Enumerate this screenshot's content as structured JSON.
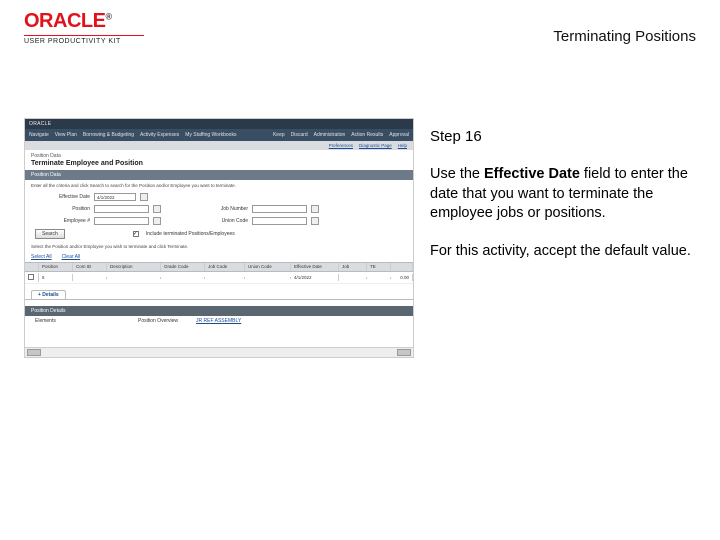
{
  "header": {
    "brand": "ORACLE",
    "brand_sub": "USER PRODUCTIVITY KIT",
    "doc_title": "Terminating Positions"
  },
  "instructions": {
    "step_label": "Step 16",
    "body_pre": "Use the ",
    "body_bold": "Effective Date",
    "body_post": " field to enter the date that you want to terminate the employee jobs or positions.",
    "body2": "For this activity, accept the default value."
  },
  "app": {
    "brand": "ORACLE",
    "nav": {
      "left": [
        "Navigate",
        "View Plan",
        "Borrowing & Budgeting",
        "Activity Expenses",
        "My Staffing Workbooks"
      ],
      "right": [
        "Keep",
        "Discard",
        "Administration",
        "Action Results",
        "Approval"
      ]
    },
    "substrip": {
      "left_link": "Preferences",
      "mid_link": "Diagnostic Page",
      "help": "Help"
    },
    "section_label": "Position Data",
    "page_title": "Terminate Employee and Position",
    "subbar": "Position Data",
    "instr_line": "Enter all the criteria and click Search to search for the Position and/or Employee you want to terminate.",
    "effective_date": {
      "label": "Effective Date",
      "value": "4/1/2022"
    },
    "filters": {
      "row1": [
        {
          "label": "Position",
          "value": ""
        },
        {
          "label": "Job Number",
          "value": ""
        }
      ],
      "row2": [
        {
          "label": "Employee #",
          "value": ""
        },
        {
          "label": "Union Code",
          "value": ""
        }
      ],
      "checkbox_label": "Include terminated Positions/Employees"
    },
    "search_btn": "Search",
    "post_search_instr": "Select the Position and/or Employee you wish to terminate and click Terminate.",
    "quick_links": {
      "select_all": "Select All",
      "clear_all": "Clear All"
    },
    "table": {
      "headers": [
        "",
        "Position",
        "Com ID",
        "Description",
        "Grade Code",
        "Job Code",
        "Union Code",
        "Effective Date",
        "Job",
        "TE",
        ""
      ],
      "row": [
        "",
        "5",
        "",
        "",
        "",
        "",
        "",
        "4/1/2022",
        "",
        "",
        "0.00"
      ]
    },
    "details_header": "Position Details",
    "details": {
      "elements_label": "Elements",
      "overview_label": "Position Overview",
      "overview_link": "JR REF ASSEMBLY"
    }
  }
}
